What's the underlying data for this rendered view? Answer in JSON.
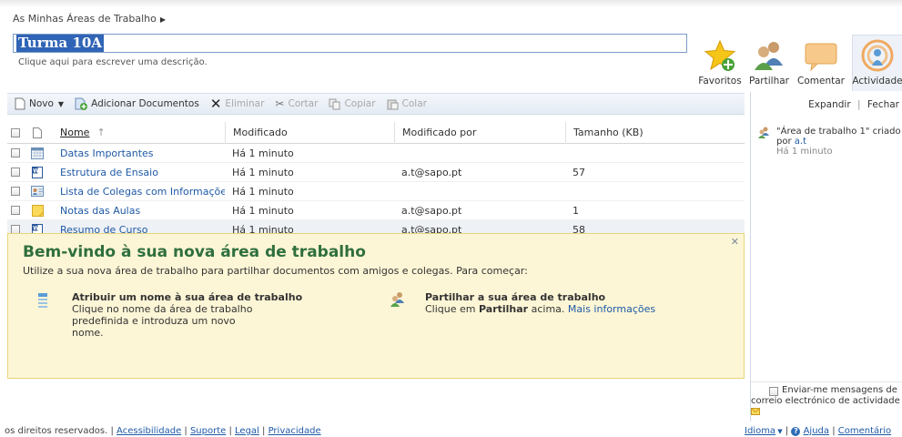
{
  "breadcrumb": {
    "text": "As Minhas Áreas de Trabalho"
  },
  "workspace": {
    "title": "Turma 10A",
    "description_placeholder": "Clique aqui para escrever uma descrição."
  },
  "ribbon": {
    "favorites": "Favoritos",
    "share": "Partilhar",
    "comment": "Comentar",
    "activity": "Actividade"
  },
  "toolbar": {
    "new": "Novo",
    "add_documents": "Adicionar Documentos",
    "delete": "Eliminar",
    "cut": "Cortar",
    "copy": "Copiar",
    "paste": "Colar"
  },
  "table": {
    "columns": {
      "name": "Nome",
      "modified": "Modificado",
      "modified_by": "Modificado por",
      "size": "Tamanho (KB)"
    },
    "rows": [
      {
        "name": "Datas Importantes",
        "modified": "Há 1 minuto",
        "modified_by": "",
        "size": "",
        "icon": "calendar-icon"
      },
      {
        "name": "Estrutura de Ensaio",
        "modified": "Há 1 minuto",
        "modified_by": "a.t@sapo.pt",
        "size": "57",
        "icon": "word-doc-icon"
      },
      {
        "name": "Lista de Colegas com Informações...",
        "modified": "Há 1 minuto",
        "modified_by": "",
        "size": "",
        "icon": "contacts-icon"
      },
      {
        "name": "Notas das Aulas",
        "modified": "Há 1 minuto",
        "modified_by": "a.t@sapo.pt",
        "size": "1",
        "icon": "notes-icon"
      },
      {
        "name": "Resumo de Curso",
        "modified": "Há 1 minuto",
        "modified_by": "a.t@sapo.pt",
        "size": "58",
        "icon": "word-doc-icon"
      }
    ]
  },
  "welcome": {
    "title": "Bem-vindo à sua nova área de trabalho",
    "intro": "Utilize a sua nova área de trabalho para partilhar documentos com amigos e colegas. Para começar:",
    "step1_head": "Atribuir um nome à sua área de trabalho",
    "step1_line1": "Clique no nome da área de trabalho",
    "step1_line2": "predefinida e introduza um novo",
    "step1_line3": "nome.",
    "step2_head": "Partilhar a sua área de trabalho",
    "step2_pre": "Clique em",
    "step2_bold": "Partilhar",
    "step2_post": "acima.",
    "step2_link": "Mais informações"
  },
  "sidepane": {
    "expand": "Expandir",
    "close": "Fechar",
    "activity_text": "\"Área de trabalho 1\" criado",
    "activity_by": "por",
    "activity_user": "a.t",
    "activity_time": "Há 1 minuto",
    "notify_line1": "Enviar-me mensagens de",
    "notify_line2": "correio electrónico de actividade"
  },
  "footer": {
    "rights": "os direitos reservados.",
    "accessibility": "Acessibilidade",
    "support": "Suporte",
    "legal": "Legal",
    "privacy": "Privacidade",
    "language": "Idioma",
    "help": "Ajuda",
    "comments": "Comentário"
  },
  "colors": {
    "link": "#1f5aa6",
    "welcome_bg": "#fdf6d6",
    "title_selection": "#3064b6"
  }
}
